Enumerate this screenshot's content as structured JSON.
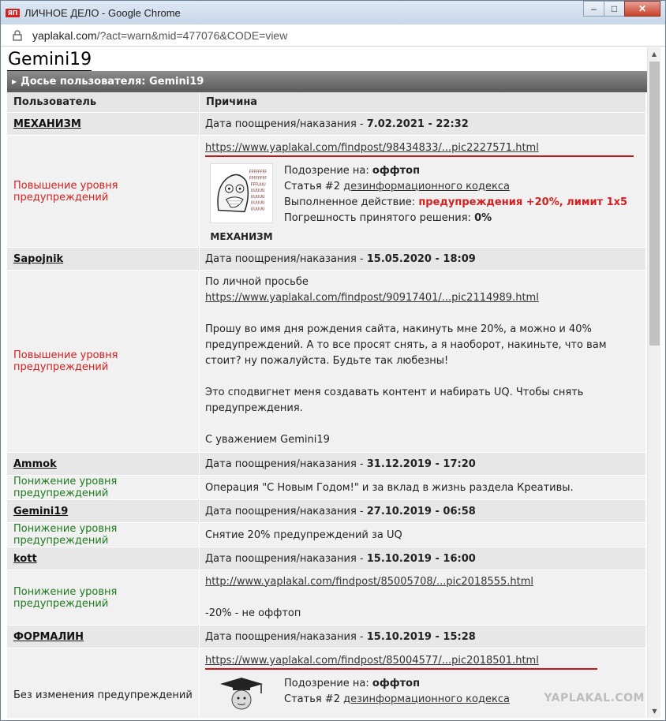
{
  "window": {
    "title": "ЛИЧНОЕ ДЕЛО - Google Chrome",
    "favicon_text": "ЯП"
  },
  "url": {
    "host": "yaplakal.com",
    "path": "/?act=warn&mid=477076&CODE=view"
  },
  "page": {
    "title": "Gemini19",
    "dossier_header": "Досье пользователя: Gemini19"
  },
  "table": {
    "col_user": "Пользователь",
    "col_reason": "Причина",
    "date_label": "Дата поощрения/наказания - ",
    "entries": [
      {
        "user": "МЕХАНИЗМ",
        "date": "7.02.2021 - 22:32",
        "level": "Повышение уровня предупреждений",
        "link": "https://www.yaplakal.com/findpost/98434833/...pic2227571.html",
        "suspicion_label": "Подозрение на: ",
        "suspicion": "оффтоп",
        "article_prefix": "Статья #2 ",
        "article_link": "дезинформационного кодекса",
        "action_label": "Выполненное действие: ",
        "action": "предупреждения +20%, лимит 1x5",
        "error_label": "Погрешность принятого решения: ",
        "error": "0%",
        "avatar_caption": "МЕХАНИЗМ"
      },
      {
        "user": "Sapojnik",
        "date": "15.05.2020 - 18:09",
        "level": "Повышение уровня предупреждений",
        "line1": "По личной просьбе",
        "link": "https://www.yaplakal.com/findpost/90917401/...pic2114989.html",
        "para1": "Прошу во имя дня рождения сайта, накинуть мне 20%, а можно и 40% предупреждений. А то все просят снять, а я наоборот, накиньте, что вам стоит? ну пожалуйста. Будьте так любезны!",
        "para2": "Это сподвигнет меня создавать контент и набирать UQ. Чтобы снять предупреждения.",
        "para3": "С уважением Gemini19"
      },
      {
        "user": "Ammok",
        "date": "31.12.2019 - 17:20",
        "level": "Понижение уровня предупреждений",
        "text": "Операция \"С Новым Годом!\" и за вклад в жизнь раздела Креативы."
      },
      {
        "user": "Gemini19",
        "date": "27.10.2019 - 06:58",
        "level": "Понижение уровня предупреждений",
        "text": "Снятие 20% предупреждений за UQ"
      },
      {
        "user": "kott",
        "date": "15.10.2019 - 16:00",
        "level": "Понижение уровня предупреждений",
        "link": "http://www.yaplakal.com/findpost/85005708/...pic2018555.html",
        "text": "-20% - не оффтоп"
      },
      {
        "user": "ФОРМАЛИН",
        "date": "15.10.2019 - 15:28",
        "level": "Без изменения предупреждений",
        "link": "https://www.yaplakal.com/findpost/85004577/...pic2018501.html",
        "suspicion_label": "Подозрение на: ",
        "suspicion": "оффтоп",
        "article_prefix": "Статья #2 ",
        "article_link": "дезинформационного кодекса"
      }
    ]
  },
  "watermark": "YAPLAKAL.COM",
  "colors": {
    "raise": "#d42020",
    "lower": "#1f7a1f",
    "header_bar": "#6e6e6e"
  }
}
